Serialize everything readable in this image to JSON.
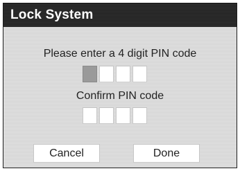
{
  "dialog": {
    "title": "Lock System",
    "pin_prompt": "Please enter a 4 digit PIN code",
    "confirm_prompt": "Confirm PIN code",
    "pin_digit_count": 4,
    "confirm_digit_count": 4,
    "active_pin_field": 1
  },
  "buttons": {
    "cancel_label": "Cancel",
    "done_label": "Done"
  },
  "colors": {
    "titlebar": "#222222",
    "dialog_background": "#d3d3d3",
    "active_field": "#9a9a9a",
    "field": "#ffffff"
  }
}
